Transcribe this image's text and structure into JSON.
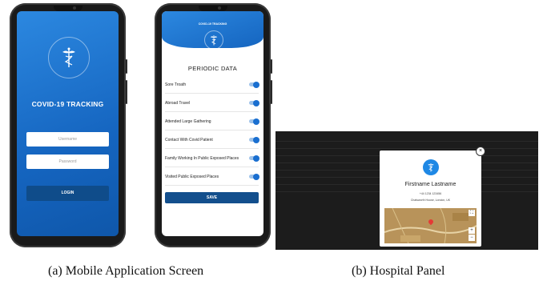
{
  "mobile": {
    "login": {
      "title": "COVID-19 TRACKING",
      "username_placeholder": "Username",
      "password_placeholder": "Password",
      "login_label": "LOGIN"
    },
    "periodic": {
      "brand": "COVID-19 TRACKING",
      "title": "PERIODIC DATA",
      "questions": [
        {
          "label": "Sore Troath",
          "on": true
        },
        {
          "label": "Abroad Travel",
          "on": true
        },
        {
          "label": "Attended Large Gathering",
          "on": true
        },
        {
          "label": "Contact With Covid Patient",
          "on": true
        },
        {
          "label": "Family Working In Public Exposed Places",
          "on": true
        },
        {
          "label": "Visited Public Exposed Places",
          "on": true
        }
      ],
      "save_label": "SAVE"
    },
    "caption": "(a) Mobile Application Screen"
  },
  "hospital": {
    "modal": {
      "name": "Firstname Lastname",
      "phone": "+44 1234 123456",
      "address": "Chatsworth House, London, UK",
      "close_symbol": "×"
    },
    "map": {
      "zoom_in": "+",
      "zoom_out": "−",
      "fullscreen": "⛶"
    },
    "caption": "(b) Hospital Panel"
  },
  "colors": {
    "primary": "#1565c0",
    "button_dark": "#0f4c8a",
    "panel_bg": "#1c1c1c"
  }
}
